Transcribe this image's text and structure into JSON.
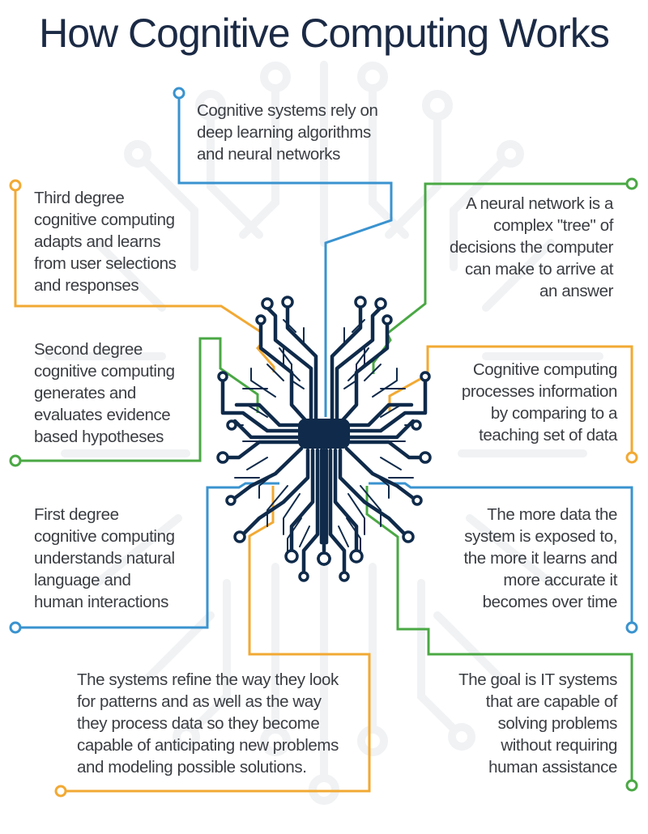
{
  "title": "How Cognitive Computing Works",
  "colors": {
    "title": "#1b2a45",
    "text": "#3a3d42",
    "chip": "#0f2a4a",
    "blue": "#3a93cf",
    "orange": "#f2a933",
    "green": "#4aa844",
    "background_pattern": "#f0f2f4"
  },
  "central_icon": "circuit-brain-chip-icon",
  "callouts": [
    {
      "id": "deep-learning",
      "color": "blue",
      "align": "left",
      "lines": [
        "Cognitive systems rely on",
        "deep learning algorithms",
        "and neural networks"
      ]
    },
    {
      "id": "third-degree",
      "color": "orange",
      "align": "left",
      "lines": [
        "Third degree",
        "cognitive computing",
        "adapts and learns",
        "from user selections",
        "and responses"
      ]
    },
    {
      "id": "neural-network",
      "color": "green",
      "align": "right",
      "lines": [
        "A neural network is a",
        "complex \"tree\" of",
        "decisions the computer",
        "can make to arrive at",
        "an answer"
      ]
    },
    {
      "id": "second-degree",
      "color": "green",
      "align": "left",
      "lines": [
        "Second degree",
        "cognitive computing",
        "generates and",
        "evaluates evidence",
        "based hypotheses"
      ]
    },
    {
      "id": "teaching-set",
      "color": "orange",
      "align": "right",
      "lines": [
        "Cognitive computing",
        "processes information",
        "by comparing to a",
        "teaching set of data"
      ]
    },
    {
      "id": "first-degree",
      "color": "blue",
      "align": "left",
      "lines": [
        "First degree",
        "cognitive computing",
        "understands natural",
        "language and",
        "human interactions"
      ]
    },
    {
      "id": "more-data",
      "color": "blue",
      "align": "right",
      "lines": [
        "The more data the",
        "system is exposed to,",
        "the more it learns and",
        "more accurate it",
        "becomes over time"
      ]
    },
    {
      "id": "refine",
      "color": "orange",
      "align": "left",
      "lines": [
        "The systems refine the way they look",
        "for patterns and as well as the way",
        "they process data so they become",
        "capable of anticipating new problems",
        "and modeling possible solutions."
      ]
    },
    {
      "id": "goal",
      "color": "green",
      "align": "right",
      "lines": [
        "The goal is IT systems",
        "that are capable of",
        "solving problems",
        "without requiring",
        "human assistance"
      ]
    }
  ]
}
